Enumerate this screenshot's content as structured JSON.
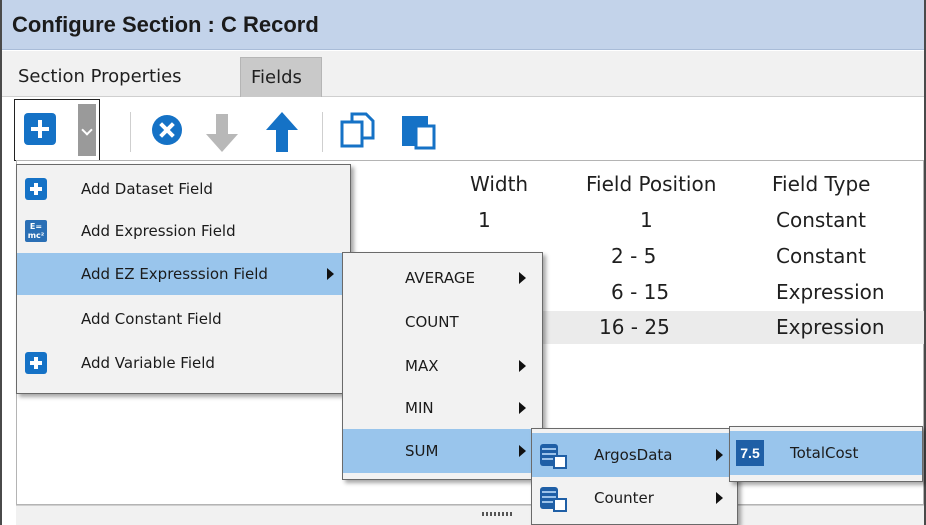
{
  "window": {
    "title": "Configure Section : C Record"
  },
  "tabs": [
    {
      "label": "Section Properties"
    },
    {
      "label": "Fields"
    }
  ],
  "toolbar": {
    "icons": [
      "add-icon",
      "dropdown-arrow-icon",
      "delete-icon",
      "move-down-icon",
      "move-up-icon",
      "copy-icon",
      "paste-icon"
    ]
  },
  "grid": {
    "columns": [
      "Width",
      "Field Position",
      "Field Type"
    ],
    "rows": [
      {
        "width": "1",
        "position": "1",
        "type": "Constant"
      },
      {
        "width": "",
        "position": "2 - 5",
        "type": "Constant"
      },
      {
        "width": "",
        "position": "6 - 15",
        "type": "Expression"
      },
      {
        "width": "",
        "position": "16 - 25",
        "type": "Expression"
      }
    ]
  },
  "menu_add": {
    "items": [
      {
        "label": "Add Dataset Field",
        "icon": "plus-icon"
      },
      {
        "label": "Add Expression Field",
        "icon": "expression-icon"
      },
      {
        "label": "Add EZ Expresssion Field",
        "icon": "",
        "submenu": true
      },
      {
        "label": "Add Constant Field",
        "icon": ""
      },
      {
        "label": "Add Variable Field",
        "icon": "plus-icon"
      }
    ]
  },
  "menu_ez": {
    "items": [
      {
        "label": "AVERAGE",
        "submenu": true
      },
      {
        "label": "COUNT",
        "submenu": false
      },
      {
        "label": "MAX",
        "submenu": true
      },
      {
        "label": "MIN",
        "submenu": true
      },
      {
        "label": "SUM",
        "submenu": true
      }
    ]
  },
  "menu_sum": {
    "items": [
      {
        "label": "ArgosData",
        "icon": "database-icon",
        "submenu": true
      },
      {
        "label": "Counter",
        "icon": "database-icon",
        "submenu": true
      }
    ]
  },
  "menu_fields": {
    "items": [
      {
        "label": "TotalCost",
        "badge": "7.5"
      }
    ]
  },
  "colors": {
    "accent": "#1572c6",
    "highlight": "#99c5ec",
    "titlebar": "#c3d3ea"
  }
}
